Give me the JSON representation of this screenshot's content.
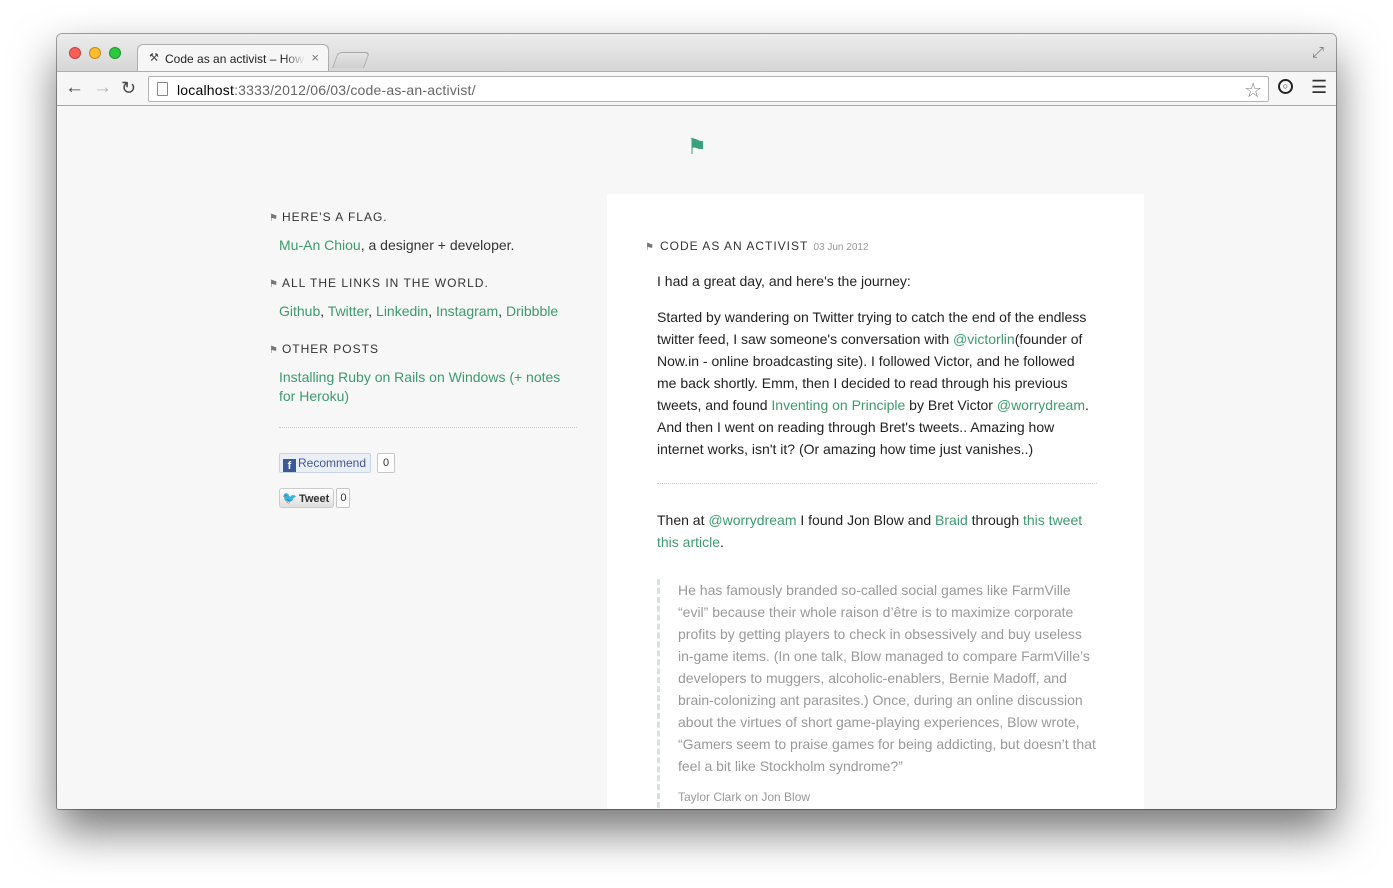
{
  "browser": {
    "tab": {
      "favicon": "⚒",
      "title": "Code as an activist – How",
      "close": "×"
    },
    "toolbar": {
      "back": "←",
      "forward": "→",
      "reload": "↻",
      "url_host": "localhost",
      "url_path": ":3333/2012/06/03/code-as-an-activist/",
      "bookmark": "☆",
      "menu": "☰",
      "fullscreen": "⤢"
    }
  },
  "site": {
    "logo": "⚑"
  },
  "sidebar": {
    "sections": [
      {
        "heading": "HERE'S A FLAG.",
        "link": "Mu-An Chiou",
        "text": ", a designer + developer."
      },
      {
        "heading": "ALL THE LINKS IN THE WORLD.",
        "links": [
          "Github",
          "Twitter",
          "Linkedin",
          "Instagram",
          "Dribbble"
        ]
      },
      {
        "heading": "OTHER POSTS",
        "link": "Installing Ruby on Rails on Windows (+ notes for Heroku)"
      }
    ],
    "social": {
      "fb_label": "Recommend",
      "fb_count": "0",
      "tw_label": "Tweet",
      "tw_count": "0"
    }
  },
  "post": {
    "title": "CODE AS AN ACTIVIST",
    "date": "03 Jun 2012",
    "intro": "I had a great day, and here's the journey:",
    "p1": {
      "a": "Started by wandering on Twitter trying to catch the end of the endless twitter feed, I saw someone's conversation with ",
      "link1": "@victorlin",
      "b": "(founder of Now.in - online broadcasting site). I followed Victor, and he followed me back shortly. Emm, then I decided to read through his previous tweets, and found ",
      "link2": "Inventing on Principle",
      "c": " by Bret Victor ",
      "link3": "@worrydream",
      "d": ". And then I went on reading through Bret's tweets.. Amazing how internet works, isn't it? (Or amazing how time just vanishes..)"
    },
    "p2": {
      "a": "Then at ",
      "link1": "@worrydream",
      "b": " I found Jon Blow and ",
      "link2": "Braid",
      "c": " through ",
      "link3": "this tweet",
      "link4": "this article",
      "d": "."
    },
    "quote": "He has famously branded so-called social games like FarmVille “evil” because their whole raison d’être is to maximize corporate profits by getting players to check in obsessively and buy useless in-game items. (In one talk, Blow managed to compare FarmVille’s developers to muggers, alcoholic-enablers, Bernie Madoff, and brain-colonizing ant parasites.) Once, during an online discussion about the virtues of short game-playing experiences, Blow wrote, “Gamers seem to praise games for being addicting, but doesn’t that feel a bit like Stockholm syndrome?”",
    "cite": "Taylor Clark on Jon Blow"
  },
  "colors": {
    "link": "#3d9a6f",
    "page_bg": "#f7f7f7",
    "post_bg": "#ffffff"
  }
}
